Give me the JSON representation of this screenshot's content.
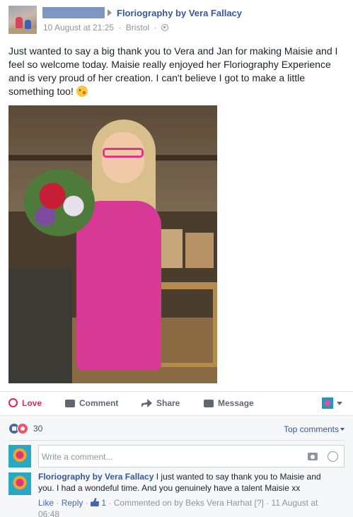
{
  "post": {
    "page_name": "Floriography by Vera Fallacy",
    "date": "10 August at 21:25",
    "separator": "·",
    "location": "Bristol",
    "globe_icon": "globe-icon",
    "text": "Just wanted to say a big thank you to Vera and Jan for making Maisie and I feel so welcome today. Maisie really enjoyed her Floriography Experience and is very proud of her creation. I can't believe I got to make a little something too!",
    "emoji_icon": "kiss-wink-emoji-icon"
  },
  "actions": {
    "love_label": "Love",
    "comment_label": "Comment",
    "share_label": "Share",
    "message_label": "Message"
  },
  "reactions": {
    "count": "30",
    "top_comments_label": "Top comments"
  },
  "composer": {
    "placeholder": "Write a comment..."
  },
  "comment": {
    "author": "Floriography by Vera Fallacy",
    "text": "I just wanted to say thank you to Maisie and you. I had a wondeful time. And you genuinely have a talent Maisie xx",
    "like_label": "Like",
    "reply_label": "Reply",
    "like_count": "1",
    "commented_on": "Commented on by Beks Vera Harhat [?]",
    "timestamp": "11 August at 06:48"
  },
  "colors": {
    "link_blue": "#365899",
    "love_red": "#e0245e",
    "muted": "#90949c"
  }
}
